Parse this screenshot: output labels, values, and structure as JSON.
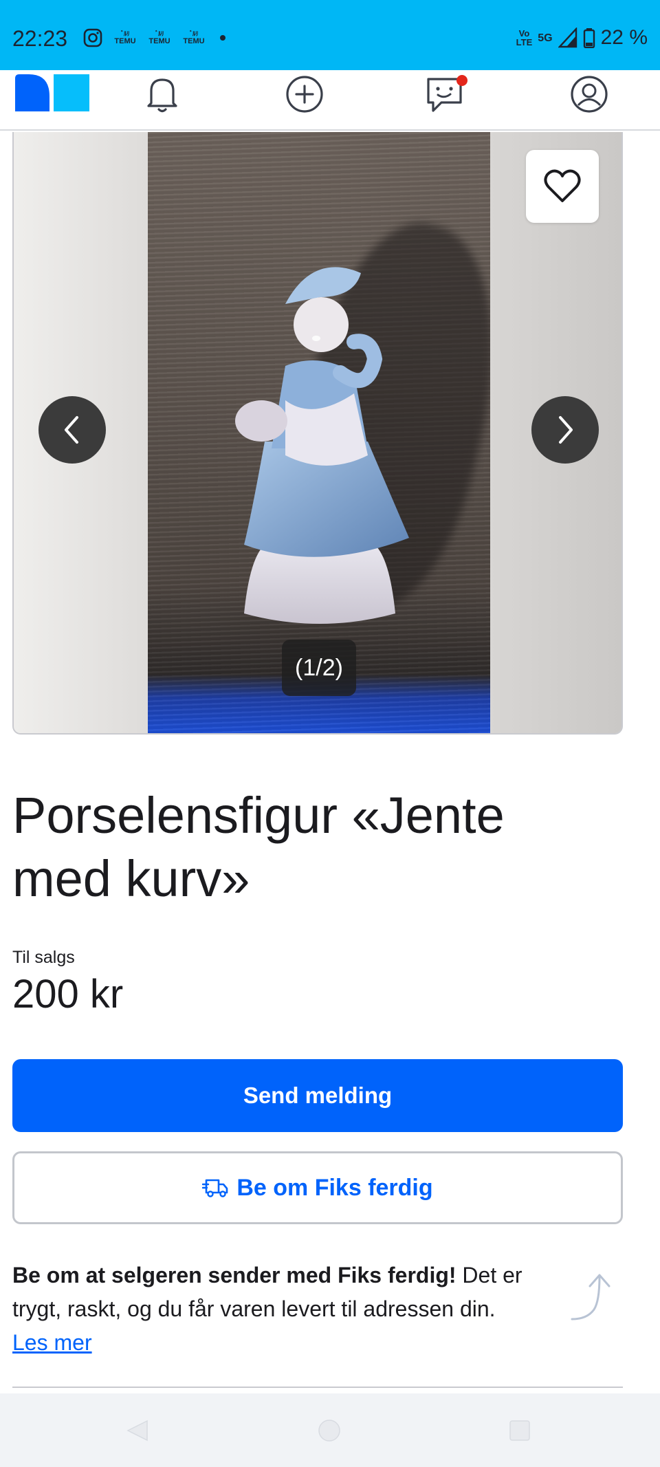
{
  "status_bar": {
    "time": "22:23",
    "notifications": [
      {
        "top": "ﾞﾙﾘ",
        "label": "TEMU"
      },
      {
        "top": "ﾞﾙﾘ",
        "label": "TEMU"
      },
      {
        "top": "ﾞﾙﾘ",
        "label": "TEMU"
      }
    ],
    "net_volte": "Vo\nLTE",
    "net_5g": "5G",
    "battery": "22 %"
  },
  "nav": {
    "icons": [
      "notifications-icon",
      "add-icon",
      "messages-icon",
      "profile-icon"
    ]
  },
  "gallery": {
    "counter": "(1/2)"
  },
  "listing": {
    "title": "Porselensfigur «Jente med kurv»",
    "sale_label": "Til salgs",
    "price": "200 kr"
  },
  "actions": {
    "send_message": "Send melding",
    "fiks_ferdig": "Be om Fiks ferdig"
  },
  "info": {
    "bold_text": "Be om at selgeren sender med Fiks ferdig!",
    "text": " Det er trygt, raskt, og du får varen levert til adressen din.",
    "read_more": "Les mer"
  },
  "colors": {
    "status_bar": "#00b7f5",
    "primary": "#0063fb",
    "notification_dot": "#e3261b"
  }
}
